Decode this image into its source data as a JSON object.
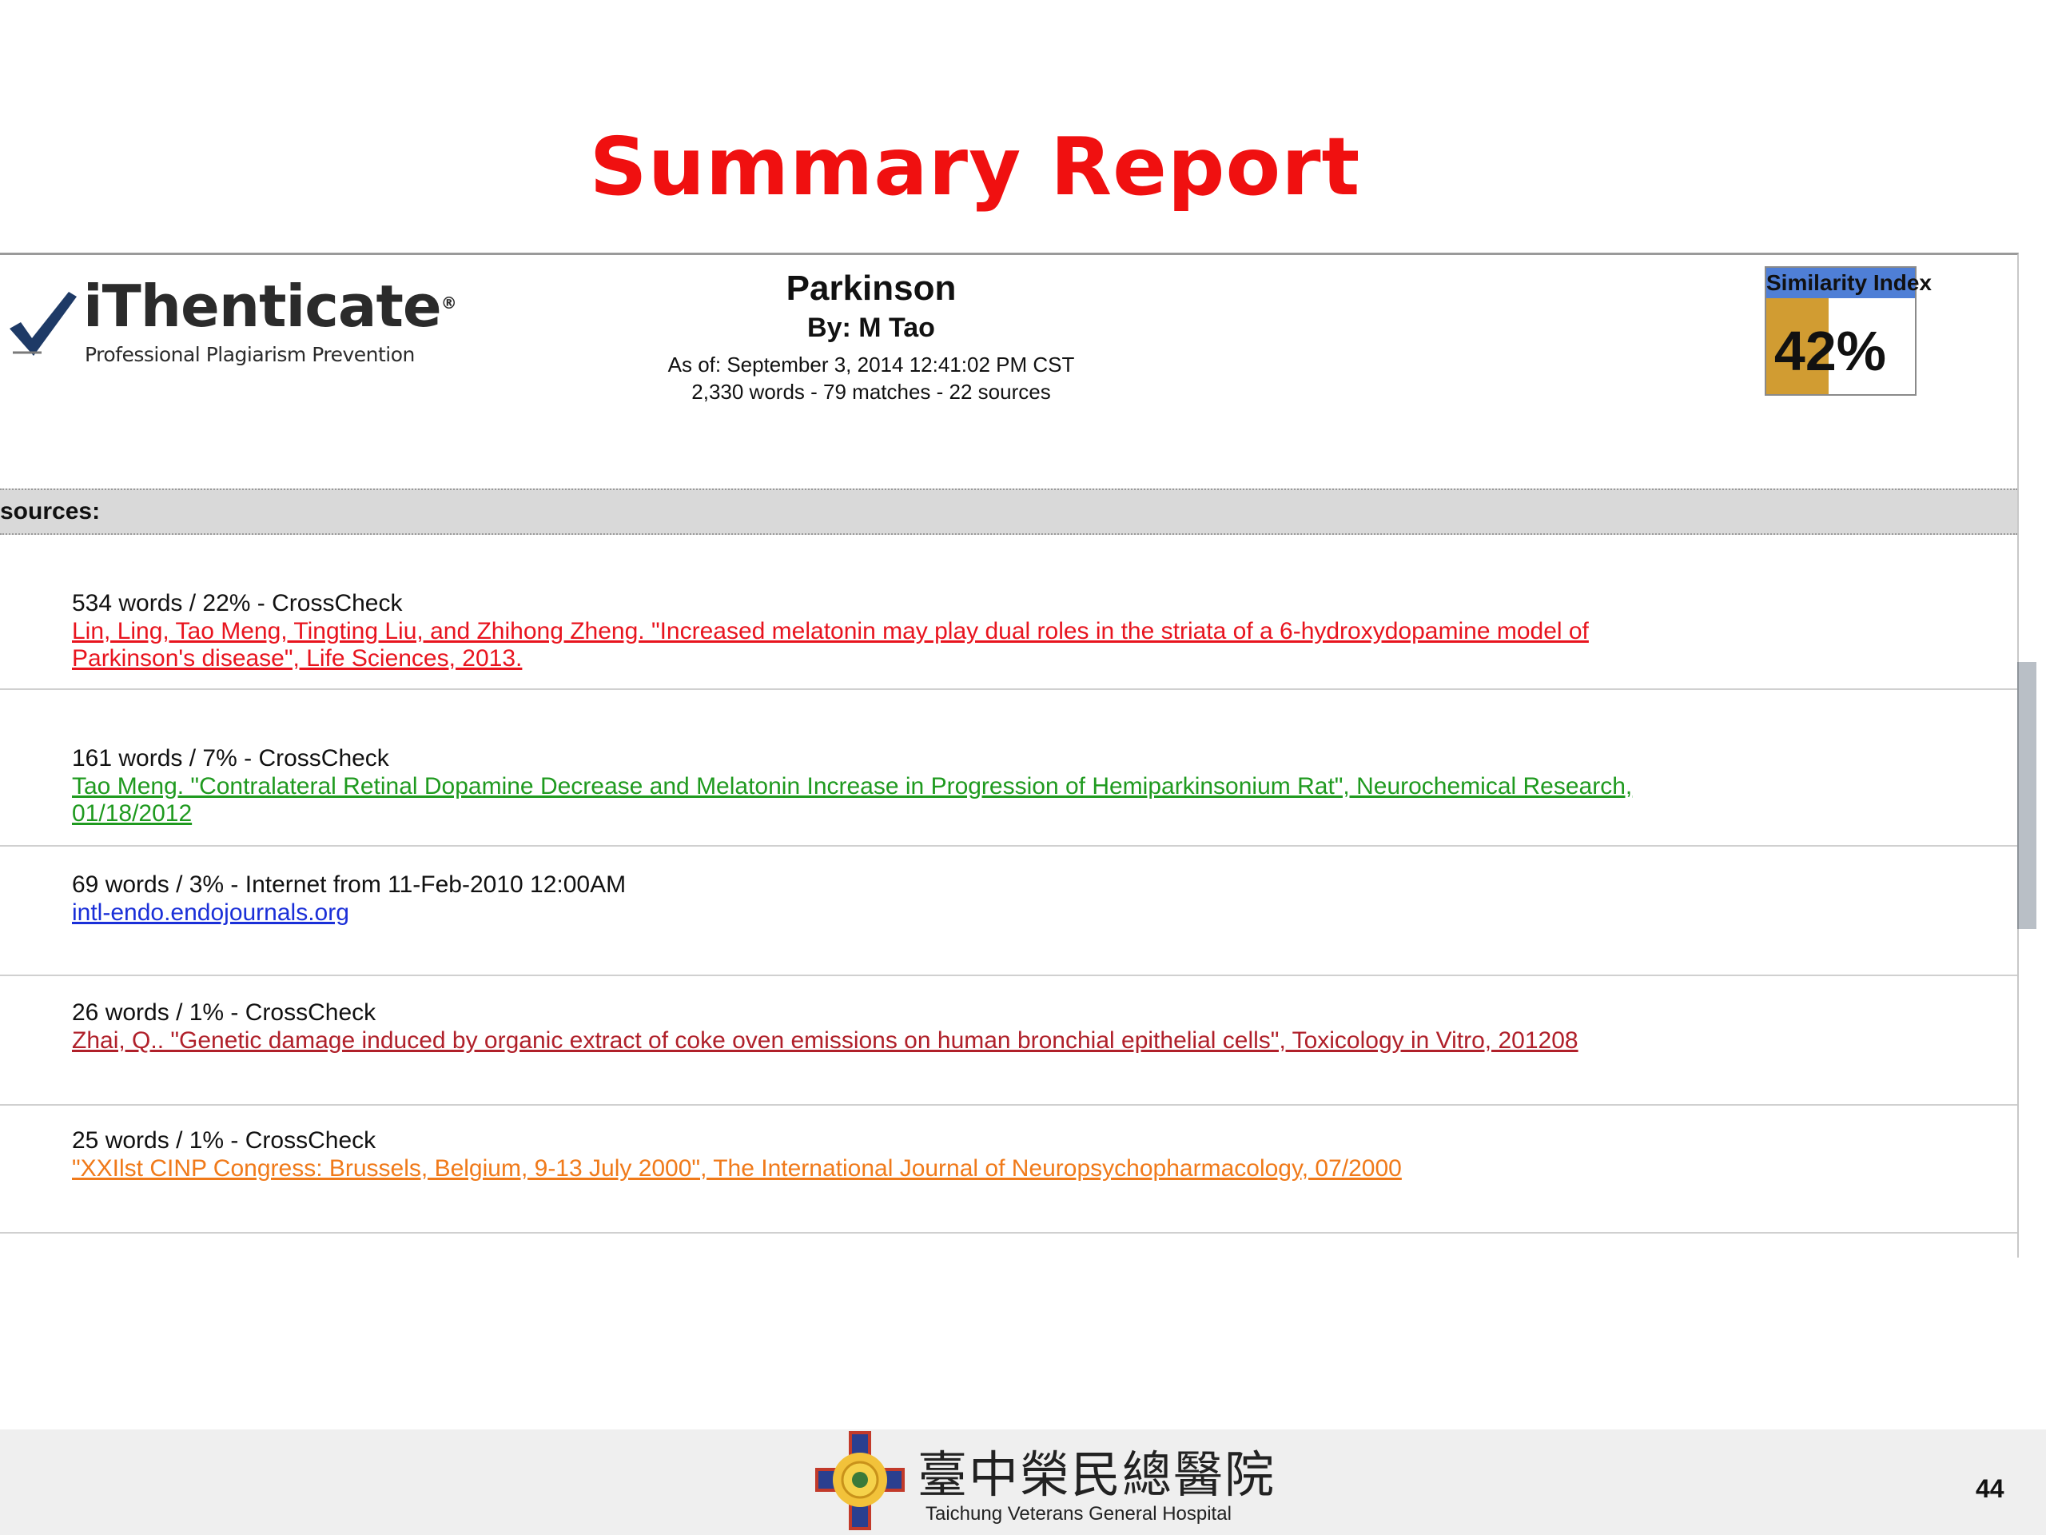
{
  "slide": {
    "title": "Summary Report",
    "page_number": "44"
  },
  "logo": {
    "name": "iThenticate",
    "registered": "®",
    "tagline": "Professional Plagiarism Prevention"
  },
  "document": {
    "title": "Parkinson",
    "author": "By: M Tao",
    "date": "As of: September 3, 2014 12:41:02 PM CST",
    "stats": "2,330 words - 79 matches - 22 sources"
  },
  "similarity": {
    "label": "Similarity Index",
    "value_text": "42%",
    "fraction": 0.42,
    "bar_color": "#d19c32",
    "label_color": "#4f7fd6"
  },
  "sources": {
    "label": "sources:",
    "items": [
      {
        "meta": "534 words / 22% - CrossCheck",
        "link": "Lin, Ling, Tao Meng, Tingting Liu, and Zhihong Zheng. \"Increased melatonin may play dual roles in the striata of a 6-hydroxydopamine model of Parkinson's disease\", Life Sciences, 2013.",
        "color": "#e8141e"
      },
      {
        "meta": "161 words / 7% - CrossCheck",
        "link": "Tao Meng. \"Contralateral Retinal Dopamine Decrease and Melatonin Increase in Progression of Hemiparkinsonium Rat\", Neurochemical Research, 01/18/2012",
        "color": "#1f9a1f"
      },
      {
        "meta": "69 words / 3% - Internet from 11-Feb-2010 12:00AM",
        "link": "intl-endo.endojournals.org",
        "color": "#1a2fd8"
      },
      {
        "meta": "26 words / 1% - CrossCheck",
        "link": "Zhai, Q.. \"Genetic damage induced by organic extract of coke oven emissions on human bronchial epithelial cells\", Toxicology in Vitro, 201208",
        "color": "#b0202a"
      },
      {
        "meta": "25 words / 1% - CrossCheck",
        "link": "\"XXIlst CINP Congress: Brussels, Belgium, 9-13 July 2000\", The International Journal of Neuropsychopharmacology, 07/2000",
        "color": "#f07a1a"
      }
    ]
  },
  "footer": {
    "hospital_cn": "臺中榮民總醫院",
    "hospital_en": "Taichung Veterans General Hospital"
  },
  "icons": {
    "logo_mark": "checkmark-icon",
    "hospital_mark": "hospital-emblem-icon"
  }
}
